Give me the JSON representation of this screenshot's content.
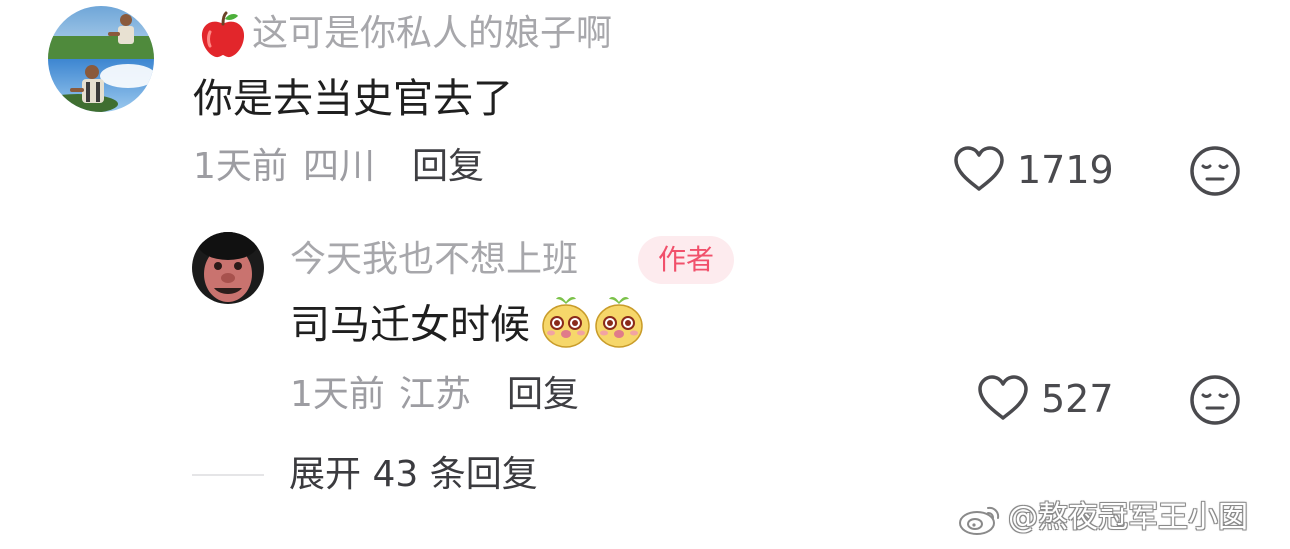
{
  "comment": {
    "username": "这可是你私人的娘子啊",
    "text": "你是去当史官去了",
    "time": "1天前",
    "location": "四川",
    "reply_label": "回复",
    "like_count": "1719",
    "username_emoji_icon": "apple-icon",
    "avatar": "avatar-icon",
    "dislike_icon": "neutral-face-icon"
  },
  "reply": {
    "username": "今天我也不想上班",
    "author_badge": "作者",
    "text": "司马迁女时候",
    "emoji_icons": [
      "cute-face-icon",
      "cute-face-icon"
    ],
    "time": "1天前",
    "location": "江苏",
    "reply_label": "回复",
    "like_count": "527",
    "avatar": "avatar-icon",
    "dislike_icon": "neutral-face-icon"
  },
  "expand_replies": {
    "label": "展开 43 条回复"
  },
  "watermark": {
    "text": "@熬夜冠军王小囡",
    "icon": "weibo-icon"
  },
  "colors": {
    "author_badge_text": "#f1506b",
    "author_badge_bg": "#fdebee",
    "muted_text": "#a7a7ab",
    "body_text": "#1f1f1f"
  }
}
